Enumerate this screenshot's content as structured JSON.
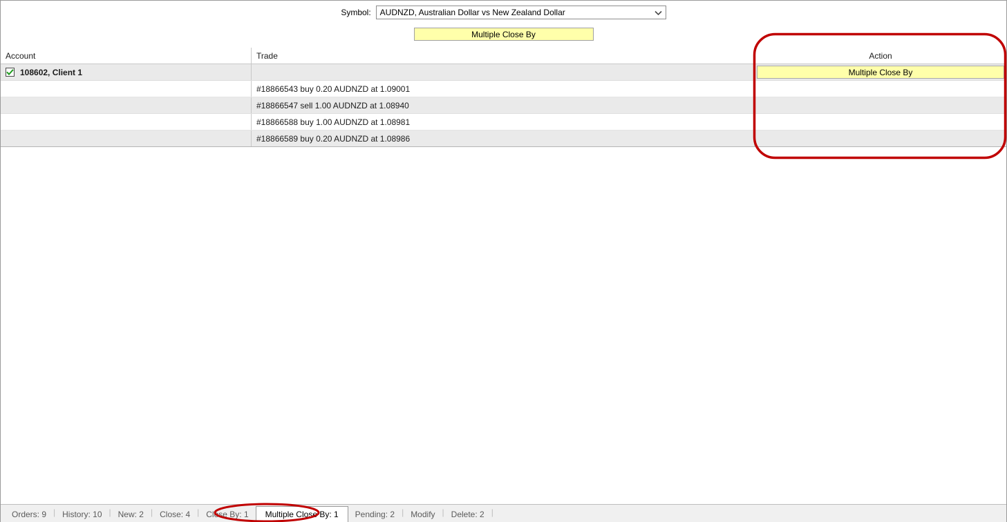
{
  "symbol": {
    "label": "Symbol:",
    "value": "AUDNZD, Australian Dollar vs New Zealand Dollar",
    "arrow_icon": "chevron-down-icon"
  },
  "toolbar": {
    "multiple_close_by_label": "Multiple Close By"
  },
  "table": {
    "headers": {
      "account": "Account",
      "trade": "Trade",
      "action": "Action"
    },
    "account_row": {
      "checked": true,
      "label": "108602, Client 1",
      "action_label": "Multiple Close By"
    },
    "trades": [
      {
        "text": "#18866543 buy 0.20 AUDNZD at 1.09001"
      },
      {
        "text": "#18866547 sell 1.00 AUDNZD at 1.08940"
      },
      {
        "text": "#18866588 buy 1.00 AUDNZD at 1.08981"
      },
      {
        "text": "#18866589 buy 0.20 AUDNZD at 1.08986"
      }
    ]
  },
  "tabs": [
    {
      "label": "Orders: 9",
      "active": false
    },
    {
      "label": "History: 10",
      "active": false
    },
    {
      "label": "New: 2",
      "active": false
    },
    {
      "label": "Close: 4",
      "active": false
    },
    {
      "label": "Close By: 1",
      "active": false
    },
    {
      "label": "Multiple Close By: 1",
      "active": true
    },
    {
      "label": "Pending: 2",
      "active": false
    },
    {
      "label": "Modify",
      "active": false
    },
    {
      "label": "Delete: 2",
      "active": false
    }
  ],
  "colors": {
    "highlight_yellow": "#ffffaa",
    "annotation_red": "#c00000",
    "check_green": "#1f9b1f",
    "row_stripe": "#eaeaea"
  }
}
